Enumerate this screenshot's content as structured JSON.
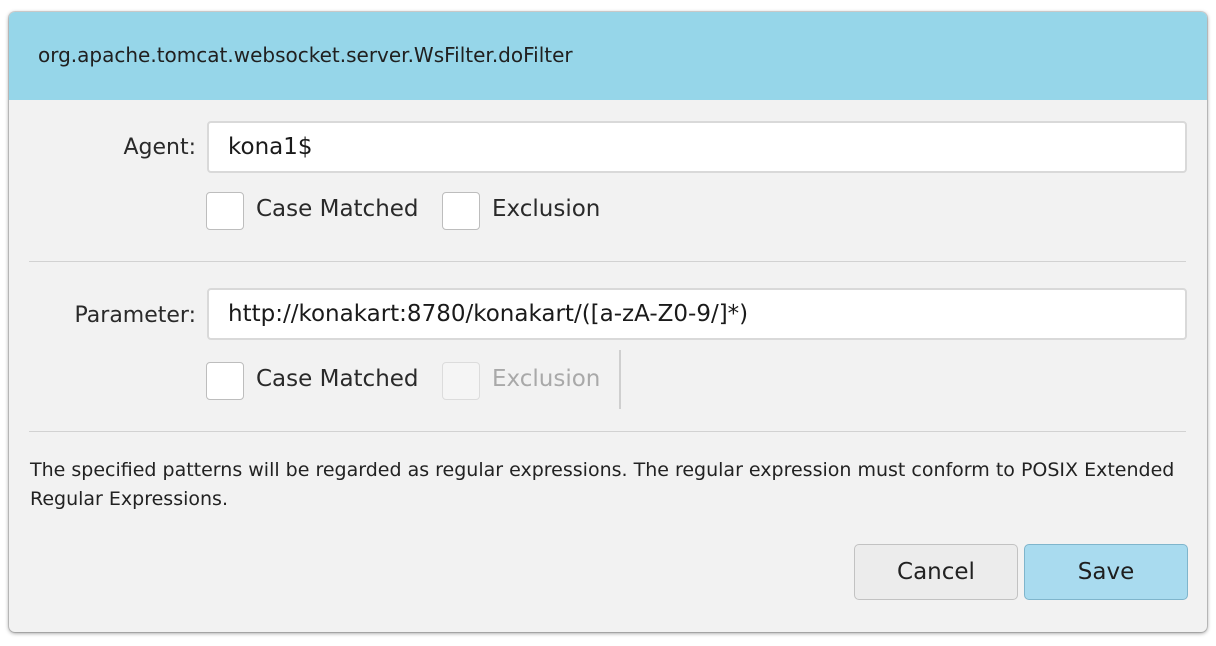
{
  "dialog": {
    "title": "org.apache.tomcat.websocket.server.WsFilter.doFilter",
    "title_bar_color": "#96d6e9"
  },
  "agent": {
    "label": "Agent:",
    "value": "kona1$",
    "case_matched": {
      "label": "Case Matched",
      "checked": false,
      "enabled": true
    },
    "exclusion": {
      "label": "Exclusion",
      "checked": false,
      "enabled": true
    }
  },
  "parameter": {
    "label": "Parameter:",
    "value": "http://konakart:8780/konakart/([a-zA-Z0-9/]*)",
    "case_matched": {
      "label": "Case Matched",
      "checked": false,
      "enabled": true
    },
    "exclusion": {
      "label": "Exclusion",
      "checked": false,
      "enabled": false
    }
  },
  "note": "The specified patterns will be regarded as regular expressions. The regular expression must conform to POSIX Extended Regular Expressions.",
  "buttons": {
    "cancel": "Cancel",
    "save": "Save",
    "save_color": "#a9dbef"
  }
}
